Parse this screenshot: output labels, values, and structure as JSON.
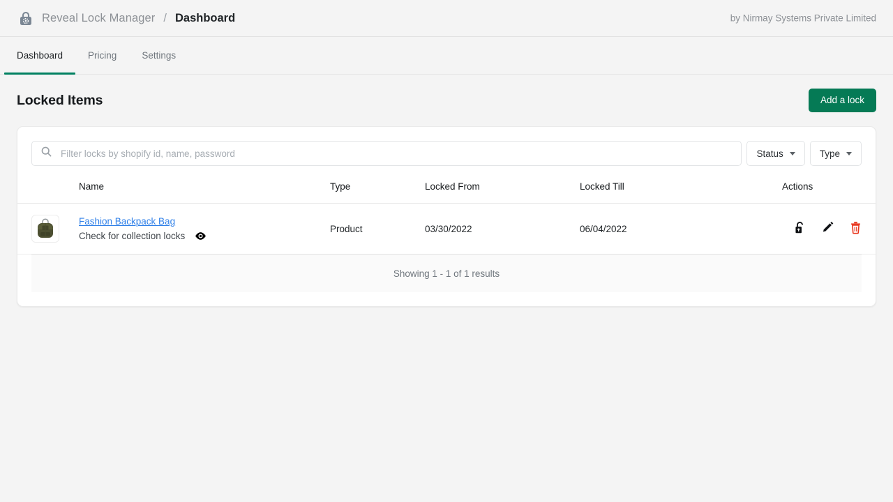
{
  "header": {
    "logo_icon": "padlock-icon",
    "brand_name": "Reveal Lock Manager",
    "separator": "/",
    "page_name": "Dashboard",
    "attribution": "by Nirmay Systems Private Limited"
  },
  "tabs": [
    {
      "label": "Dashboard",
      "active": true
    },
    {
      "label": "Pricing",
      "active": false
    },
    {
      "label": "Settings",
      "active": false
    }
  ],
  "page": {
    "title": "Locked Items",
    "add_button_label": "Add a lock",
    "accent_color": "#057a55"
  },
  "filters": {
    "search_icon": "search-icon",
    "search_value": "",
    "search_placeholder": "Filter locks by shopify id, name, password",
    "status_label": "Status",
    "type_label": "Type"
  },
  "table": {
    "columns": [
      "Name",
      "Type",
      "Locked From",
      "Locked Till",
      "Actions"
    ],
    "rows": [
      {
        "thumbnail_icon": "backpack-thumbnail",
        "name": "Fashion Backpack Bag",
        "subtitle": "Check for collection locks",
        "subtitle_icon": "eye-icon",
        "type": "Product",
        "locked_from": "03/30/2022",
        "locked_till": "06/04/2022",
        "actions": [
          "unlock-icon",
          "edit-icon",
          "delete-icon"
        ]
      }
    ]
  },
  "footer": {
    "results_text": "Showing 1 - 1 of 1 results"
  }
}
